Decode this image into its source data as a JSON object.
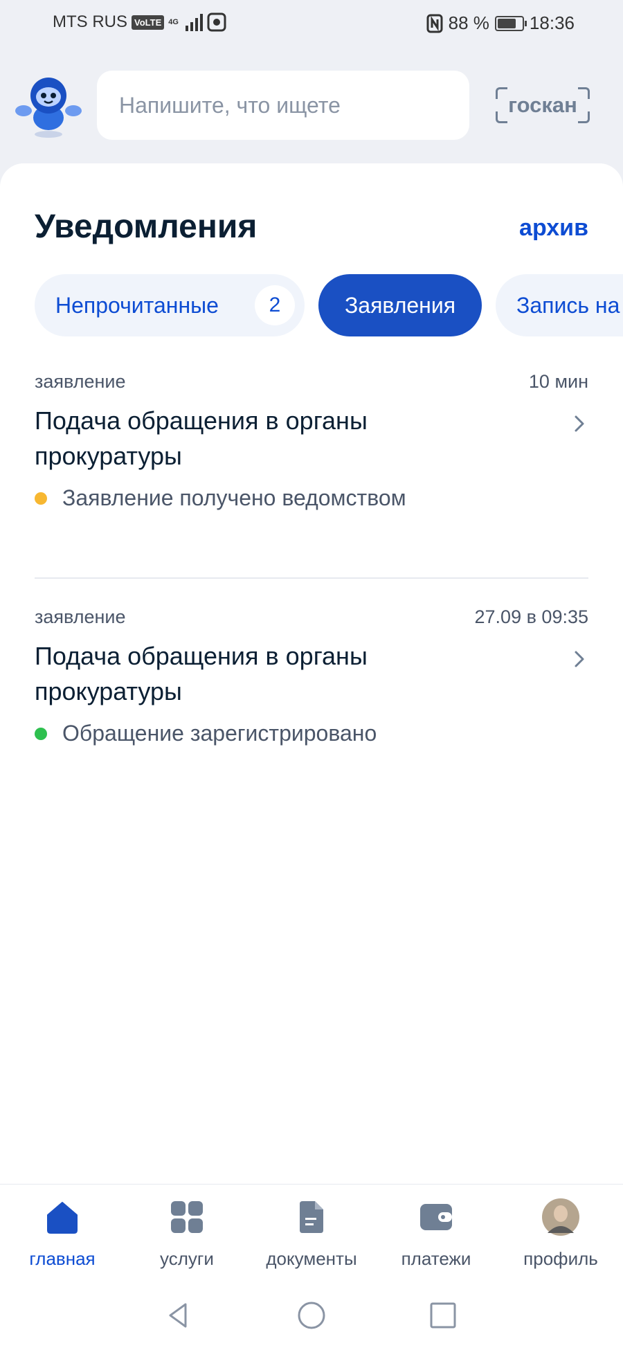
{
  "status_bar": {
    "carrier": "MTS RUS",
    "volte": "VoLTE",
    "network": "4G",
    "battery": "88 %",
    "time": "18:36"
  },
  "header": {
    "search_placeholder": "Напишите, что ищете",
    "scan_label": "госкан"
  },
  "notifications": {
    "title": "Уведомления",
    "archive_label": "архив",
    "filters": [
      {
        "label": "Непрочитанные",
        "count": "2",
        "active": false
      },
      {
        "label": "Заявления",
        "active": true
      },
      {
        "label": "Запись на",
        "active": false
      }
    ],
    "items": [
      {
        "type": "заявление",
        "time": "10 мин",
        "title": "Подача обращения в органы прокуратуры",
        "status": "Заявление получено ведомством",
        "status_color": "#f7b731"
      },
      {
        "type": "заявление",
        "time": "27.09 в 09:35",
        "title": "Подача обращения в органы прокуратуры",
        "status": "Обращение зарегистрировано",
        "status_color": "#2ec04f"
      }
    ]
  },
  "tabbar": {
    "tabs": [
      {
        "label": "главная",
        "icon": "home-icon",
        "active": true
      },
      {
        "label": "услуги",
        "icon": "grid-icon",
        "active": false
      },
      {
        "label": "документы",
        "icon": "document-icon",
        "active": false
      },
      {
        "label": "платежи",
        "icon": "wallet-icon",
        "active": false
      },
      {
        "label": "профиль",
        "icon": "profile-avatar",
        "active": false
      }
    ]
  },
  "colors": {
    "accent": "#0d4cd3",
    "chip_active": "#1a50c3",
    "icon_gray": "#6f7f94"
  }
}
